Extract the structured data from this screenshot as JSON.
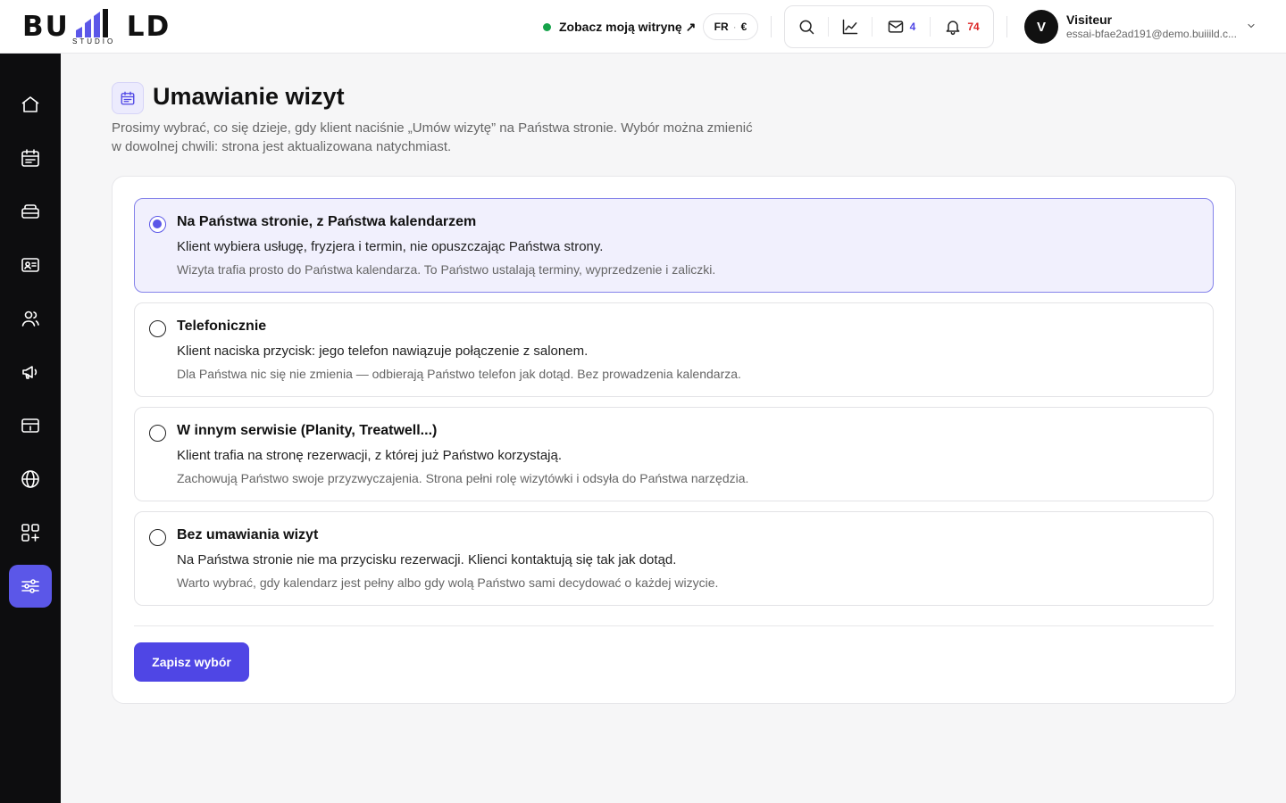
{
  "brand": {
    "name": "BUILD",
    "sub": "STUDIO",
    "bars_color": "#5b57e8"
  },
  "topbar": {
    "view_site": "Zobacz moją witrynę ↗",
    "lang": "FR",
    "currency": "€",
    "mail_count": "4",
    "notif_count": "74",
    "user": {
      "initial": "V",
      "name": "Visiteur",
      "email": "essai-bfae2ad191@demo.buiiild.c..."
    }
  },
  "sidebar": {
    "items": [
      {
        "icon": "home-icon"
      },
      {
        "icon": "calendar-icon"
      },
      {
        "icon": "services-icon"
      },
      {
        "icon": "contact-card-icon"
      },
      {
        "icon": "users-icon"
      },
      {
        "icon": "megaphone-icon"
      },
      {
        "icon": "payment-icon"
      },
      {
        "icon": "globe-icon"
      },
      {
        "icon": "apps-icon"
      },
      {
        "icon": "settings-sliders-icon",
        "active": true
      }
    ]
  },
  "page": {
    "title": "Umawianie wizyt",
    "description": "Prosimy wybrać, co się dzieje, gdy klient naciśnie „Umów wizytę” na Państwa stronie. Wybór można zmienić w dowolnej chwili: strona jest aktualizowana natychmiast."
  },
  "options": [
    {
      "title": "Na Państwa stronie, z Państwa kalendarzem",
      "line1": "Klient wybiera usługę, fryzjera i termin, nie opuszczając Państwa strony.",
      "line2": "Wizyta trafia prosto do Państwa kalendarza. To Państwo ustalają terminy, wyprzedzenie i zaliczki.",
      "selected": true
    },
    {
      "title": "Telefonicznie",
      "line1": "Klient naciska przycisk: jego telefon nawiązuje połączenie z salonem.",
      "line2": "Dla Państwa nic się nie zmienia — odbierają Państwo telefon jak dotąd. Bez prowadzenia kalendarza.",
      "selected": false
    },
    {
      "title": "W innym serwisie (Planity, Treatwell...)",
      "line1": "Klient trafia na stronę rezerwacji, z której już Państwo korzystają.",
      "line2": "Zachowują Państwo swoje przyzwyczajenia. Strona pełni rolę wizytówki i odsyła do Państwa narzędzia.",
      "selected": false
    },
    {
      "title": "Bez umawiania wizyt",
      "line1": "Na Państwa stronie nie ma przycisku rezerwacji. Klienci kontaktują się tak jak dotąd.",
      "line2": "Warto wybrać, gdy kalendarz jest pełny albo gdy wolą Państwo sami decydować o każdej wizycie.",
      "selected": false
    }
  ],
  "save_label": "Zapisz wybór",
  "colors": {
    "accent": "#4f46e5",
    "accent_light": "#f1f0fd",
    "online": "#16a34a",
    "alert": "#dc2626"
  }
}
